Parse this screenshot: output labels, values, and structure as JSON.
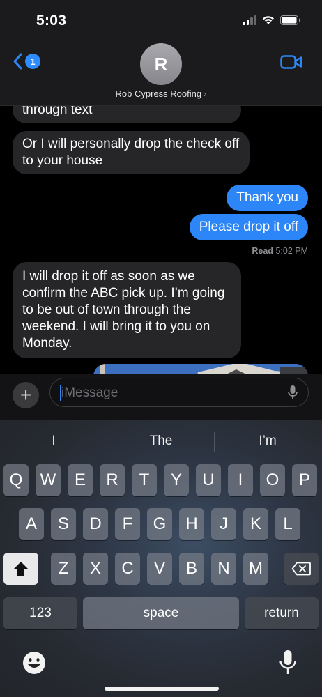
{
  "status_bar": {
    "time": "5:03"
  },
  "header": {
    "back_badge": "1",
    "avatar_initial": "R",
    "contact_name": "Rob Cypress Roofing",
    "contact_chevron": "›"
  },
  "messages": [
    {
      "direction": "incoming",
      "text": "through text"
    },
    {
      "direction": "incoming",
      "text": "Or I will personally drop the check off to your house"
    },
    {
      "direction": "outgoing",
      "text": "Thank you"
    },
    {
      "direction": "outgoing",
      "text": "Please drop it off"
    },
    {
      "direction": "incoming",
      "text": "I will drop it off as soon as we confirm the ABC pick up. I’m going to be out of town through the weekend. I will bring it to you on Monday."
    }
  ],
  "read_receipt": {
    "label": "Read",
    "time": "5:02 PM"
  },
  "input": {
    "placeholder": "iMessage",
    "plus": "+"
  },
  "keyboard": {
    "suggestions": [
      "I",
      "The",
      "I’m"
    ],
    "row1": [
      "Q",
      "W",
      "E",
      "R",
      "T",
      "Y",
      "U",
      "I",
      "O",
      "P"
    ],
    "row2": [
      "A",
      "S",
      "D",
      "F",
      "G",
      "H",
      "J",
      "K",
      "L"
    ],
    "row3": [
      "Z",
      "X",
      "C",
      "V",
      "B",
      "N",
      "M"
    ],
    "numbers_key": "123",
    "space_key": "space",
    "return_key": "return"
  },
  "colors": {
    "accent": "#2d86f7",
    "incoming_bubble": "#262628",
    "outgoing_bubble": "#2d86f7"
  }
}
